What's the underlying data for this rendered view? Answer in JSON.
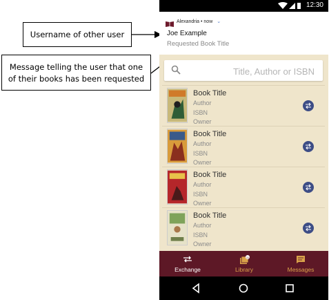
{
  "annotations": {
    "username_callout": "Username of other user",
    "message_callout_line1": "Message telling the user that one",
    "message_callout_line2": "of their books has been requested"
  },
  "status_bar": {
    "time": "12:30"
  },
  "notification": {
    "app_name": "Alexandria • now",
    "username": "Joe Example",
    "message": "Requested Book Title"
  },
  "search": {
    "placeholder": "Title, Author or ISBN",
    "value": ""
  },
  "books": [
    {
      "title": "Book Title",
      "author": "Author",
      "isbn": "ISBN",
      "owner": "Owner"
    },
    {
      "title": "Book Title",
      "author": "Author",
      "isbn": "ISBN",
      "owner": "Owner"
    },
    {
      "title": "Book Title",
      "author": "Author",
      "isbn": "ISBN",
      "owner": "Owner"
    },
    {
      "title": "Book Title",
      "author": "Author",
      "isbn": "ISBN",
      "owner": "Owner"
    }
  ],
  "bottom_nav": {
    "items": [
      {
        "label": "Exchange",
        "icon": "exchange-icon",
        "active": true
      },
      {
        "label": "Library",
        "icon": "library-icon",
        "badge": "11",
        "active": false
      },
      {
        "label": "Messages",
        "icon": "messages-icon",
        "active": false
      }
    ]
  },
  "colors": {
    "bottom_nav_bg": "#5d1826",
    "nav_active": "#ffffff",
    "nav_inactive": "#d9a24a",
    "app_background": "#efe5cb",
    "exchange_button": "#3d4d86"
  }
}
